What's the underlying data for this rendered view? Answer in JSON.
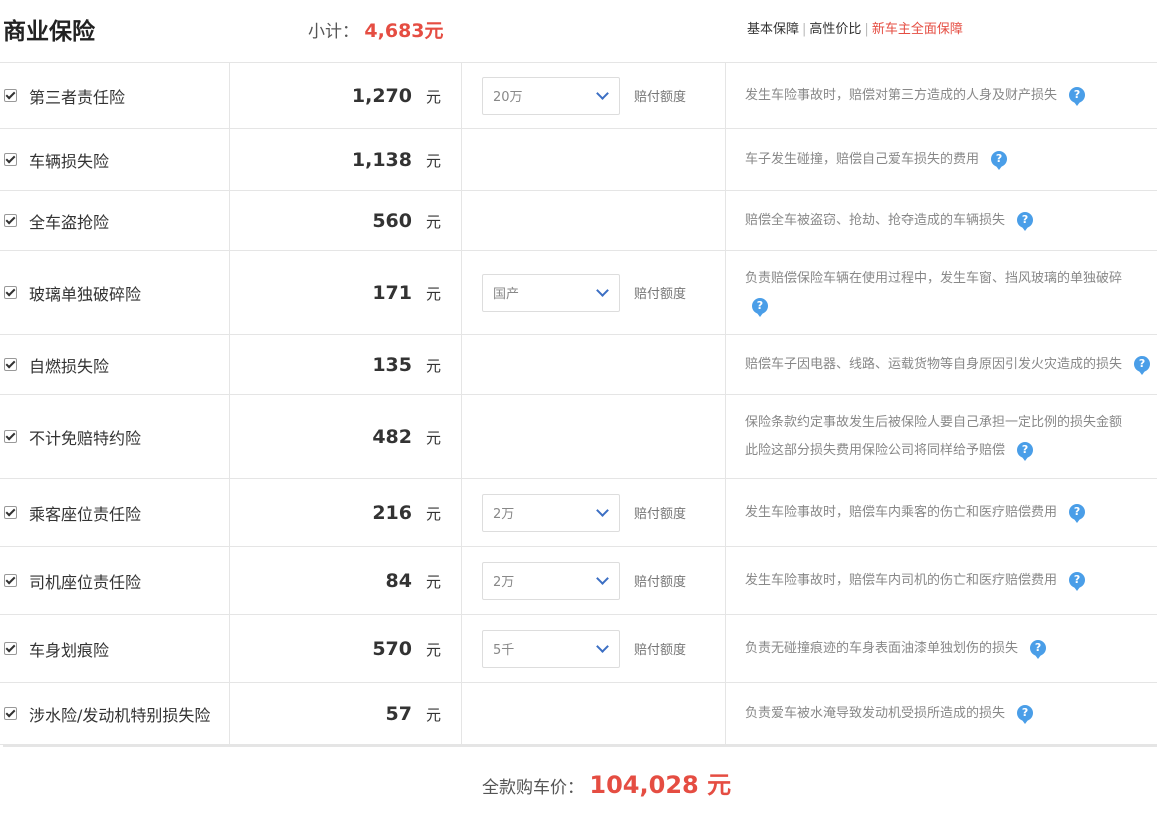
{
  "header": {
    "title": "商业保险",
    "subtotal_label": "小计：",
    "subtotal_value": "4,683元",
    "links": [
      {
        "label": "基本保障"
      },
      {
        "label": "高性价比"
      },
      {
        "label": "新车主全面保障"
      }
    ]
  },
  "pay_label": "赔付额度",
  "unit": "元",
  "help_glyph": "?",
  "rows": [
    {
      "name": "第三者责任险",
      "price": "1,270",
      "select": "20万",
      "desc": "发生车险事故时，赔偿对第三方造成的人身及财产损失",
      "checked": true
    },
    {
      "name": "车辆损失险",
      "price": "1,138",
      "select": "",
      "desc": "车子发生碰撞，赔偿自己爱车损失的费用",
      "checked": true
    },
    {
      "name": "全车盗抢险",
      "price": "560",
      "select": "",
      "desc": "赔偿全车被盗窃、抢劫、抢夺造成的车辆损失",
      "checked": true
    },
    {
      "name": "玻璃单独破碎险",
      "price": "171",
      "select": "国产",
      "desc": "负责赔偿保险车辆在使用过程中，发生车窗、挡风玻璃的单独破碎",
      "checked": true
    },
    {
      "name": "自燃损失险",
      "price": "135",
      "select": "",
      "desc": "赔偿车子因电器、线路、运载货物等自身原因引发火灾造成的损失",
      "checked": true
    },
    {
      "name": "不计免赔特约险",
      "price": "482",
      "select": "",
      "desc": "保险条款约定事故发生后被保险人要自己承担一定比例的损失金额",
      "desc2": "此险这部分损失费用保险公司将同样给予赔偿",
      "checked": true
    },
    {
      "name": "乘客座位责任险",
      "price": "216",
      "select": "2万",
      "desc": "发生车险事故时，赔偿车内乘客的伤亡和医疗赔偿费用",
      "checked": true
    },
    {
      "name": "司机座位责任险",
      "price": "84",
      "select": "2万",
      "desc": "发生车险事故时，赔偿车内司机的伤亡和医疗赔偿费用",
      "checked": true
    },
    {
      "name": "车身划痕险",
      "price": "570",
      "select": "5千",
      "desc": "负责无碰撞痕迹的车身表面油漆单独划伤的损失",
      "checked": true
    },
    {
      "name": "涉水险/发动机特别损失险",
      "price": "57",
      "select": "",
      "desc": "负责爱车被水淹导致发动机受损所造成的损失",
      "checked": true
    }
  ],
  "footer": {
    "total_label": "全款购车价：",
    "total_value": "104,028 元"
  },
  "colors": {
    "accent": "#e54d42",
    "help": "#4a9ee8"
  }
}
